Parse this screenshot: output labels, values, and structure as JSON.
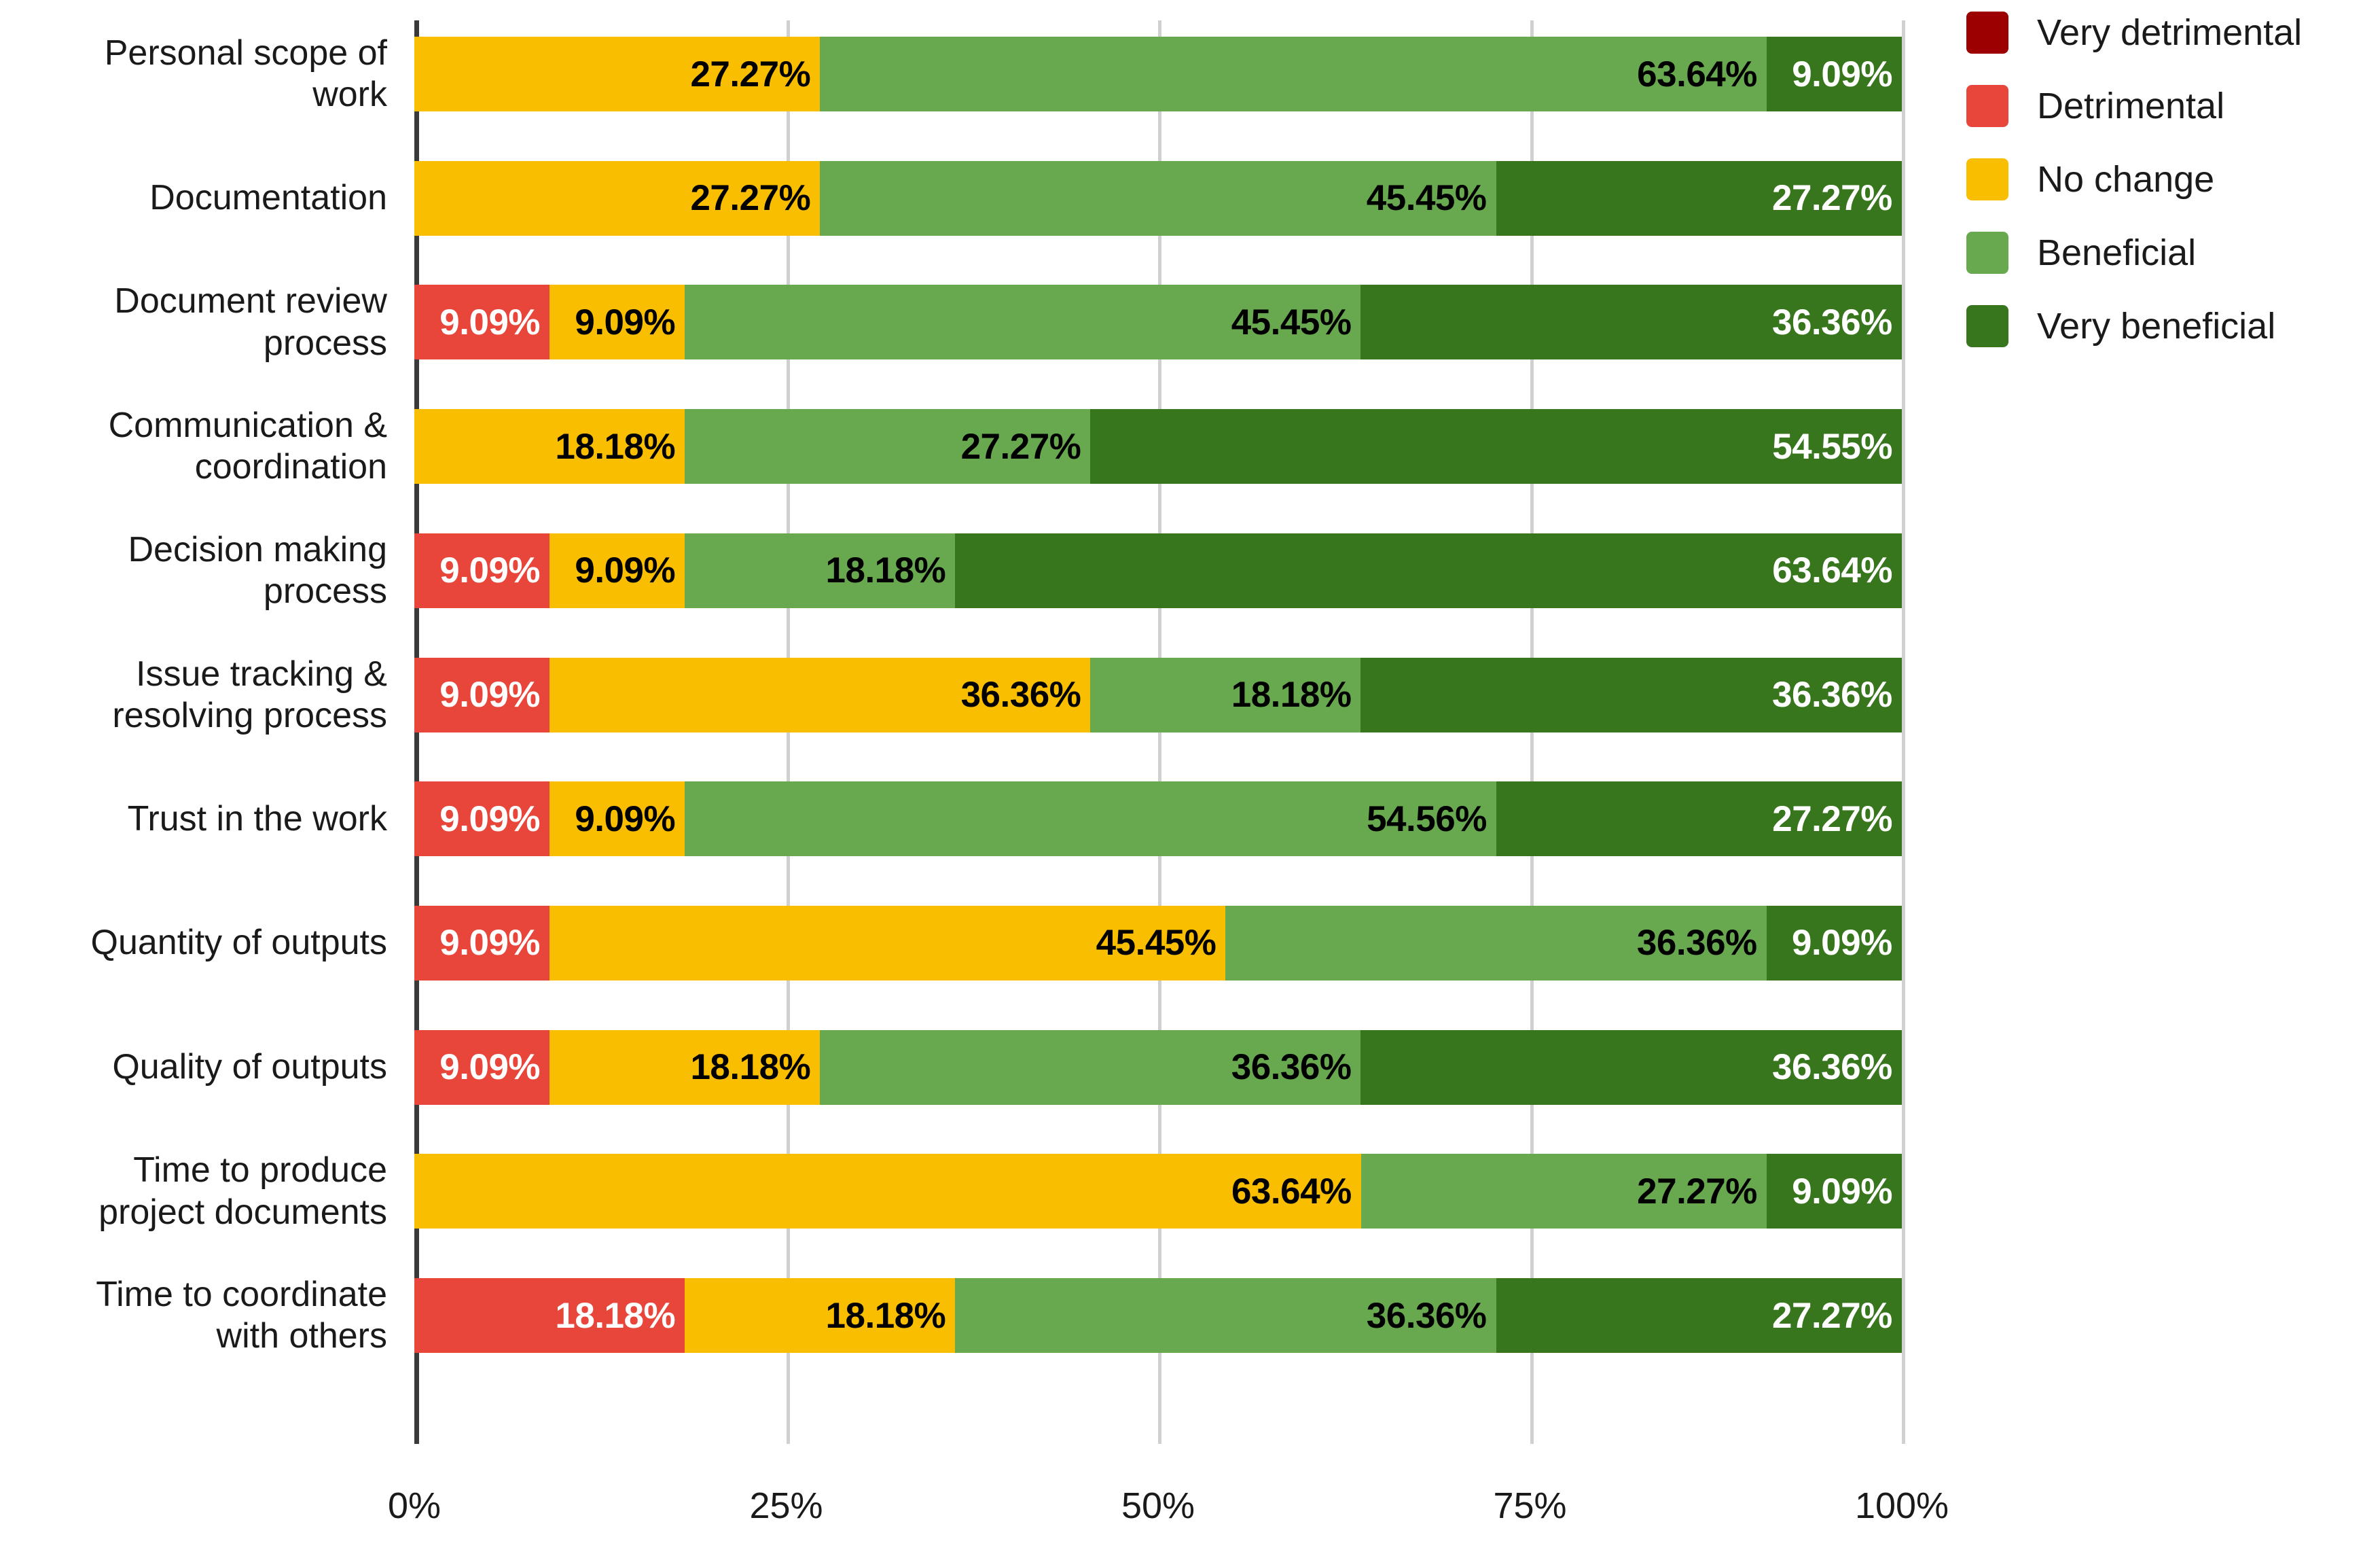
{
  "chart_data": {
    "type": "bar",
    "subtype": "stacked-horizontal-100-percent",
    "title": "",
    "xlabel": "",
    "ylabel": "",
    "xlim": [
      0,
      100
    ],
    "xticks": [
      "0%",
      "25%",
      "50%",
      "75%",
      "100%"
    ],
    "xtick_values": [
      0,
      25,
      50,
      75,
      100
    ],
    "grid": "vertical",
    "legend_position": "right",
    "value_suffix": "%",
    "colors": {
      "very_detrimental": "#9C0000",
      "detrimental": "#E8463A",
      "no_change": "#F9BE00",
      "beneficial": "#68A84E",
      "very_beneficial": "#38761D"
    },
    "legend": [
      {
        "label": "Very detrimental",
        "color": "#9C0000"
      },
      {
        "label": "Detrimental",
        "color": "#E8463A"
      },
      {
        "label": "No change",
        "color": "#F9BE00"
      },
      {
        "label": "Beneficial",
        "color": "#68A84E"
      },
      {
        "label": "Very beneficial",
        "color": "#38761D"
      }
    ],
    "series": [
      {
        "name": "Very detrimental",
        "color": "#9C0000",
        "values": [
          0,
          0,
          0,
          0,
          0,
          0,
          0,
          0,
          0,
          0,
          0
        ]
      },
      {
        "name": "Detrimental",
        "color": "#E8463A",
        "values": [
          0,
          0,
          9.09,
          0,
          9.09,
          9.09,
          9.09,
          9.09,
          9.09,
          0,
          18.18
        ]
      },
      {
        "name": "No change",
        "color": "#F9BE00",
        "values": [
          27.27,
          27.27,
          9.09,
          18.18,
          9.09,
          36.36,
          9.09,
          45.45,
          18.18,
          63.64,
          18.18
        ]
      },
      {
        "name": "Beneficial",
        "color": "#68A84E",
        "values": [
          63.64,
          45.45,
          45.45,
          27.27,
          18.18,
          18.18,
          54.56,
          36.36,
          36.36,
          27.27,
          36.36
        ]
      },
      {
        "name": "Very beneficial",
        "color": "#38761D",
        "values": [
          9.09,
          27.27,
          36.36,
          54.55,
          63.64,
          36.36,
          27.27,
          9.09,
          36.36,
          9.09,
          27.27
        ]
      }
    ],
    "categories": [
      "Personal scope of\nwork",
      "Documentation",
      "Document review\nprocess",
      "Communication &\ncoordination",
      "Decision making\nprocess",
      "Issue tracking &\nresolving process",
      "Trust in the work",
      "Quantity of outputs",
      "Quality of outputs",
      "Time to produce\nproject documents",
      "Time to coordinate\nwith others"
    ],
    "rows": [
      {
        "category": "Personal scope of\nwork",
        "segments": [
          {
            "series": "No change",
            "value": 27.27,
            "label": "27.27%",
            "color": "#F9BE00",
            "text_color": "dark"
          },
          {
            "series": "Beneficial",
            "value": 63.64,
            "label": "63.64%",
            "color": "#68A84E",
            "text_color": "dark"
          },
          {
            "series": "Very beneficial",
            "value": 9.09,
            "label": "9.09%",
            "color": "#38761D",
            "text_color": "light"
          }
        ]
      },
      {
        "category": "Documentation",
        "segments": [
          {
            "series": "No change",
            "value": 27.27,
            "label": "27.27%",
            "color": "#F9BE00",
            "text_color": "dark"
          },
          {
            "series": "Beneficial",
            "value": 45.45,
            "label": "45.45%",
            "color": "#68A84E",
            "text_color": "dark"
          },
          {
            "series": "Very beneficial",
            "value": 27.27,
            "label": "27.27%",
            "color": "#38761D",
            "text_color": "light"
          }
        ]
      },
      {
        "category": "Document review\nprocess",
        "segments": [
          {
            "series": "Detrimental",
            "value": 9.09,
            "label": "9.09%",
            "color": "#E8463A",
            "text_color": "light"
          },
          {
            "series": "No change",
            "value": 9.09,
            "label": "9.09%",
            "color": "#F9BE00",
            "text_color": "dark"
          },
          {
            "series": "Beneficial",
            "value": 45.45,
            "label": "45.45%",
            "color": "#68A84E",
            "text_color": "dark"
          },
          {
            "series": "Very beneficial",
            "value": 36.36,
            "label": "36.36%",
            "color": "#38761D",
            "text_color": "light"
          }
        ]
      },
      {
        "category": "Communication &\ncoordination",
        "segments": [
          {
            "series": "No change",
            "value": 18.18,
            "label": "18.18%",
            "color": "#F9BE00",
            "text_color": "dark"
          },
          {
            "series": "Beneficial",
            "value": 27.27,
            "label": "27.27%",
            "color": "#68A84E",
            "text_color": "dark"
          },
          {
            "series": "Very beneficial",
            "value": 54.55,
            "label": "54.55%",
            "color": "#38761D",
            "text_color": "light"
          }
        ]
      },
      {
        "category": "Decision making\nprocess",
        "segments": [
          {
            "series": "Detrimental",
            "value": 9.09,
            "label": "9.09%",
            "color": "#E8463A",
            "text_color": "light"
          },
          {
            "series": "No change",
            "value": 9.09,
            "label": "9.09%",
            "color": "#F9BE00",
            "text_color": "dark"
          },
          {
            "series": "Beneficial",
            "value": 18.18,
            "label": "18.18%",
            "color": "#68A84E",
            "text_color": "dark"
          },
          {
            "series": "Very beneficial",
            "value": 63.64,
            "label": "63.64%",
            "color": "#38761D",
            "text_color": "light"
          }
        ]
      },
      {
        "category": "Issue tracking &\nresolving process",
        "segments": [
          {
            "series": "Detrimental",
            "value": 9.09,
            "label": "9.09%",
            "color": "#E8463A",
            "text_color": "light"
          },
          {
            "series": "No change",
            "value": 36.36,
            "label": "36.36%",
            "color": "#F9BE00",
            "text_color": "dark"
          },
          {
            "series": "Beneficial",
            "value": 18.18,
            "label": "18.18%",
            "color": "#68A84E",
            "text_color": "dark"
          },
          {
            "series": "Very beneficial",
            "value": 36.36,
            "label": "36.36%",
            "color": "#38761D",
            "text_color": "light"
          }
        ]
      },
      {
        "category": "Trust in the work",
        "segments": [
          {
            "series": "Detrimental",
            "value": 9.09,
            "label": "9.09%",
            "color": "#E8463A",
            "text_color": "light"
          },
          {
            "series": "No change",
            "value": 9.09,
            "label": "9.09%",
            "color": "#F9BE00",
            "text_color": "dark"
          },
          {
            "series": "Beneficial",
            "value": 54.56,
            "label": "54.56%",
            "color": "#68A84E",
            "text_color": "dark"
          },
          {
            "series": "Very beneficial",
            "value": 27.27,
            "label": "27.27%",
            "color": "#38761D",
            "text_color": "light"
          }
        ]
      },
      {
        "category": "Quantity of outputs",
        "segments": [
          {
            "series": "Detrimental",
            "value": 9.09,
            "label": "9.09%",
            "color": "#E8463A",
            "text_color": "light"
          },
          {
            "series": "No change",
            "value": 45.45,
            "label": "45.45%",
            "color": "#F9BE00",
            "text_color": "dark"
          },
          {
            "series": "Beneficial",
            "value": 36.36,
            "label": "36.36%",
            "color": "#68A84E",
            "text_color": "dark"
          },
          {
            "series": "Very beneficial",
            "value": 9.09,
            "label": "9.09%",
            "color": "#38761D",
            "text_color": "light"
          }
        ]
      },
      {
        "category": "Quality of outputs",
        "segments": [
          {
            "series": "Detrimental",
            "value": 9.09,
            "label": "9.09%",
            "color": "#E8463A",
            "text_color": "light"
          },
          {
            "series": "No change",
            "value": 18.18,
            "label": "18.18%",
            "color": "#F9BE00",
            "text_color": "dark"
          },
          {
            "series": "Beneficial",
            "value": 36.36,
            "label": "36.36%",
            "color": "#68A84E",
            "text_color": "dark"
          },
          {
            "series": "Very beneficial",
            "value": 36.36,
            "label": "36.36%",
            "color": "#38761D",
            "text_color": "light"
          }
        ]
      },
      {
        "category": "Time to produce\nproject documents",
        "segments": [
          {
            "series": "No change",
            "value": 63.64,
            "label": "63.64%",
            "color": "#F9BE00",
            "text_color": "dark"
          },
          {
            "series": "Beneficial",
            "value": 27.27,
            "label": "27.27%",
            "color": "#68A84E",
            "text_color": "dark"
          },
          {
            "series": "Very beneficial",
            "value": 9.09,
            "label": "9.09%",
            "color": "#38761D",
            "text_color": "light"
          }
        ]
      },
      {
        "category": "Time to coordinate\nwith others",
        "segments": [
          {
            "series": "Detrimental",
            "value": 18.18,
            "label": "18.18%",
            "color": "#E8463A",
            "text_color": "light"
          },
          {
            "series": "No change",
            "value": 18.18,
            "label": "18.18%",
            "color": "#F9BE00",
            "text_color": "dark"
          },
          {
            "series": "Beneficial",
            "value": 36.36,
            "label": "36.36%",
            "color": "#68A84E",
            "text_color": "dark"
          },
          {
            "series": "Very beneficial",
            "value": 27.27,
            "label": "27.27%",
            "color": "#38761D",
            "text_color": "light"
          }
        ]
      }
    ]
  }
}
